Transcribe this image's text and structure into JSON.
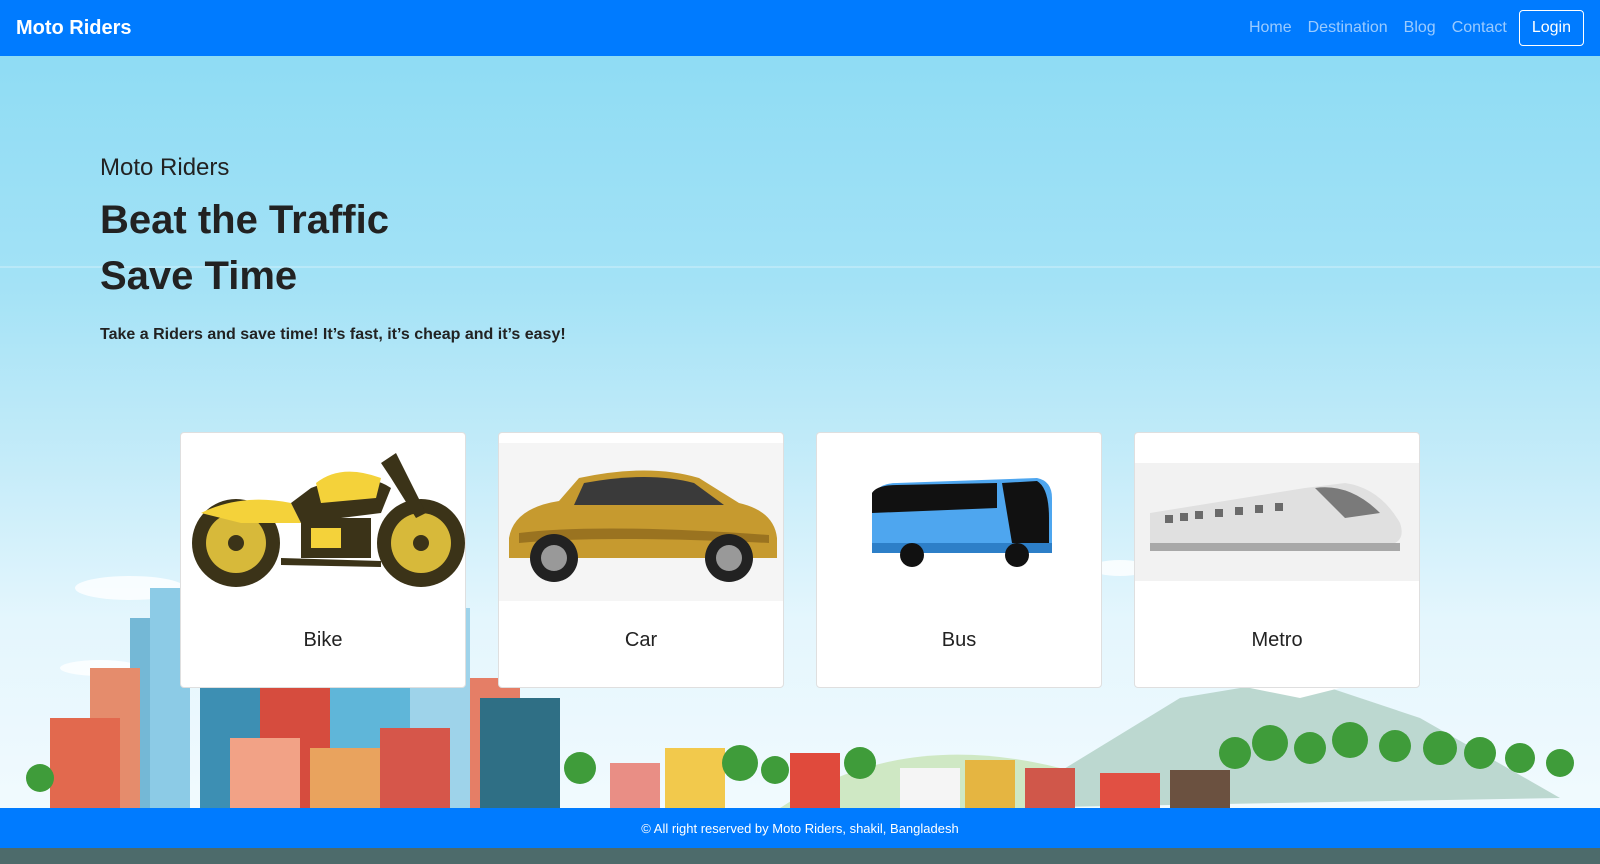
{
  "navbar": {
    "brand": "Moto Riders",
    "links": [
      "Home",
      "Destination",
      "Blog",
      "Contact"
    ],
    "login_label": "Login"
  },
  "hero": {
    "eyebrow": "Moto Riders",
    "title_line1": "Beat the Traffic",
    "title_line2": "Save Time",
    "subtitle": "Take a Riders and save time! It’s fast, it’s cheap and it’s easy!"
  },
  "cards": [
    {
      "label": "Bike",
      "icon": "motorbike-image"
    },
    {
      "label": "Car",
      "icon": "car-image"
    },
    {
      "label": "Bus",
      "icon": "bus-image"
    },
    {
      "label": "Metro",
      "icon": "metro-train-image"
    }
  ],
  "footer": {
    "text": "© All right reserved by Moto Riders, shakil, Bangladesh"
  },
  "colors": {
    "primary": "#007bff",
    "hero_sky": "#9fe1f5"
  }
}
